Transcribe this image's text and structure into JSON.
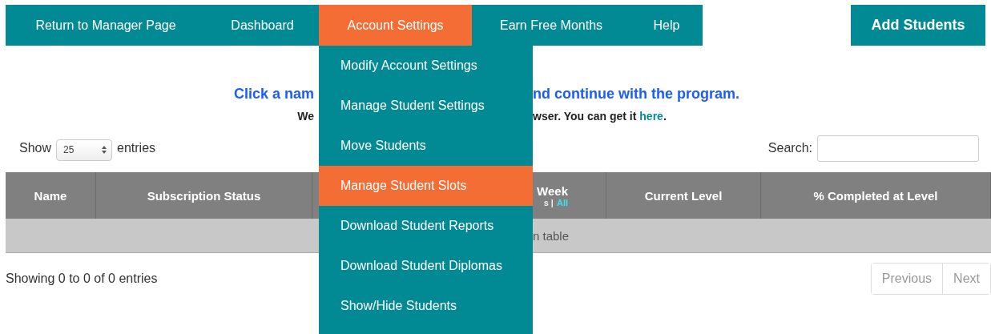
{
  "nav": {
    "items": [
      {
        "label": "Return to Manager Page",
        "selected": false
      },
      {
        "label": "Dashboard",
        "selected": false
      },
      {
        "label": "Account Settings",
        "selected": true
      },
      {
        "label": "Earn Free Months",
        "selected": false
      },
      {
        "label": "Help",
        "selected": false
      }
    ],
    "action": "Add Students"
  },
  "dropdown": {
    "items": [
      {
        "label": "Modify Account Settings",
        "selected": false
      },
      {
        "label": "Manage Student Settings",
        "selected": false
      },
      {
        "label": "Move Students",
        "selected": false
      },
      {
        "label": "Manage Student Slots",
        "selected": true
      },
      {
        "label": "Download Student Reports",
        "selected": false
      },
      {
        "label": "Download Student Diplomas",
        "selected": false
      },
      {
        "label": "Show/Hide Students",
        "selected": false
      }
    ]
  },
  "notice": {
    "line_1_left": "Click a nam",
    "line_1_right": "nd continue with the program.",
    "line_2_left": "We",
    "line_2_right": "wser. You can get it ",
    "line_2_link": "here",
    "line_2_end": "."
  },
  "length": {
    "label_before": "Show",
    "value": "25",
    "label_after": "entries"
  },
  "search": {
    "label": "Search:"
  },
  "table": {
    "columns": [
      {
        "label": "Name"
      },
      {
        "label": "Subscription Status"
      },
      {
        "label": "Week",
        "sub_text": "s |",
        "sub_link": "All"
      },
      {
        "label": "Current Level"
      },
      {
        "label": "% Completed at Level"
      }
    ],
    "empty_text": "n table"
  },
  "info": "Showing 0 to 0 of 0 entries",
  "pagination": [
    "Previous",
    "Next"
  ]
}
